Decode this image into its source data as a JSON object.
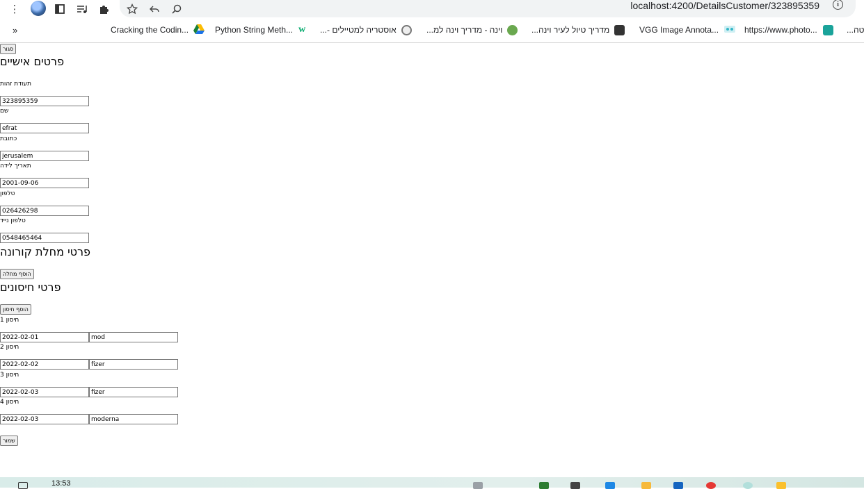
{
  "browser": {
    "url": "localhost:4200/DetailsCustomer/323895359",
    "more_glyph": "⋮",
    "bookmarks_more_glyph": "»",
    "bookmarks": [
      {
        "label": "Cracking the Codin...",
        "icon": "google-drive-icon",
        "color": "#1a73e8"
      },
      {
        "label": "Python String Meth...",
        "icon": "w3schools-icon",
        "color": "#04aa6d"
      },
      {
        "label": "אוסטריה למטיילים -...",
        "icon": "site-icon",
        "color": "#777777"
      },
      {
        "label": "וינה - מדריך וינה למ...",
        "icon": "globe-icon",
        "color": "#6aa84f"
      },
      {
        "label": "מדריך טיול לעיר וינה...",
        "icon": "site-icon",
        "color": "#333333"
      },
      {
        "label": "VGG Image Annota...",
        "icon": "vgg-icon",
        "color": "#35b7c8"
      },
      {
        "label": "https://www.photo...",
        "icon": "photo-icon",
        "color": "#1aa39a"
      },
      {
        "label": "...טה",
        "icon": "",
        "color": ""
      }
    ]
  },
  "page": {
    "close_button": "סגור",
    "personal_heading": "פרטים אישיים",
    "fields": [
      {
        "label": "תעודת זהות",
        "value": "323895359"
      },
      {
        "label": "שם",
        "value": "efrat"
      },
      {
        "label": "כתובת",
        "value": "jerusalem"
      },
      {
        "label": "תאריך לידה",
        "value": "2001-09-06"
      },
      {
        "label": "טלפון",
        "value": "026426298"
      },
      {
        "label": "טלפון נייד",
        "value": "0548465464"
      }
    ],
    "corona_heading": "פרטי מחלת קורונה",
    "add_illness_button": "הוסף מחלה",
    "vaccines_heading": "פרטי חיסונים",
    "add_vaccine_button": "הוסף חיסון",
    "vaccines": [
      {
        "label": "חיסון 1",
        "date": "2022-02-01",
        "maker": "mod"
      },
      {
        "label": "חיסון 2",
        "date": "2022-02-02",
        "maker": "fizer"
      },
      {
        "label": "חיסון 3",
        "date": "2022-02-03",
        "maker": "fizer"
      },
      {
        "label": "חיסון 4",
        "date": "2022-02-03",
        "maker": "moderna"
      }
    ],
    "save_button": "שמור"
  },
  "taskbar": {
    "clock": "13:53"
  }
}
